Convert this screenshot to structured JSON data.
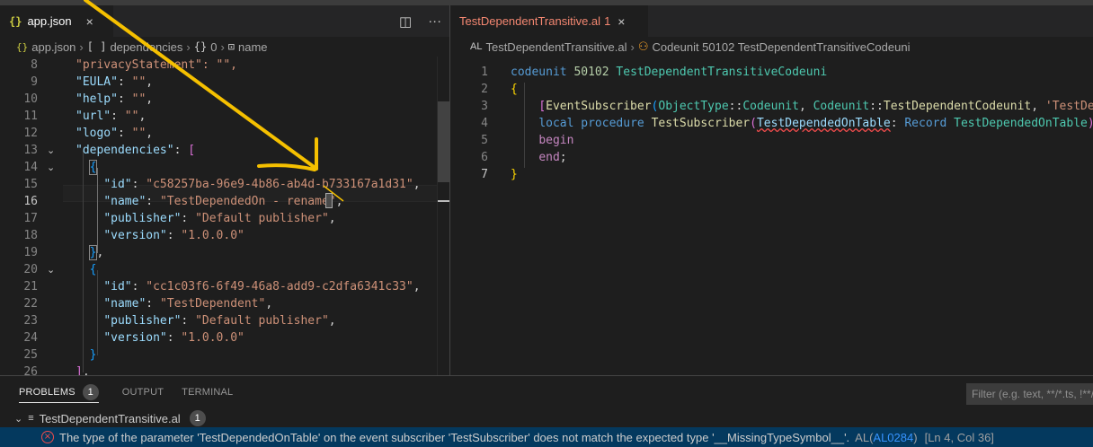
{
  "left_editor": {
    "tab": {
      "icon": "{}",
      "label": "app.json",
      "close": "×"
    },
    "actions": {
      "split": "◫",
      "more": "···"
    },
    "breadcrumb": {
      "file_icon": "{}",
      "file": "app.json",
      "seg1_icon": "[ ]",
      "seg1": "dependencies",
      "seg2_icon": "{}",
      "seg2": "0",
      "seg3_icon": "⊡",
      "seg3": "name",
      "sep": "›"
    },
    "lines": [
      {
        "n": "8",
        "tokens": [
          [
            "s",
            "\"privacyStatement\": \"\","
          ]
        ]
      },
      {
        "n": "9",
        "tokens": [
          [
            "k",
            "\"EULA\""
          ],
          [
            "p",
            ": "
          ],
          [
            "s",
            "\"\""
          ],
          [
            "p",
            ","
          ]
        ]
      },
      {
        "n": "10",
        "tokens": [
          [
            "k",
            "\"help\""
          ],
          [
            "p",
            ": "
          ],
          [
            "s",
            "\"\""
          ],
          [
            "p",
            ","
          ]
        ]
      },
      {
        "n": "11",
        "tokens": [
          [
            "k",
            "\"url\""
          ],
          [
            "p",
            ": "
          ],
          [
            "s",
            "\"\""
          ],
          [
            "p",
            ","
          ]
        ]
      },
      {
        "n": "12",
        "tokens": [
          [
            "k",
            "\"logo\""
          ],
          [
            "p",
            ": "
          ],
          [
            "s",
            "\"\""
          ],
          [
            "p",
            ","
          ]
        ]
      },
      {
        "n": "13",
        "tokens": [
          [
            "k",
            "\"dependencies\""
          ],
          [
            "p",
            ": "
          ],
          [
            "br1",
            "["
          ]
        ]
      },
      {
        "n": "14",
        "tokens": [
          [
            "p",
            "  "
          ],
          [
            "br2",
            "{"
          ]
        ]
      },
      {
        "n": "15",
        "tokens": [
          [
            "p",
            "    "
          ],
          [
            "k",
            "\"id\""
          ],
          [
            "p",
            ": "
          ],
          [
            "s",
            "\"c58257ba-96e9-4b86-ab4d-b733167a1d31\""
          ],
          [
            "p",
            ","
          ]
        ]
      },
      {
        "n": "16",
        "tokens": [
          [
            "p",
            "    "
          ],
          [
            "k",
            "\"name\""
          ],
          [
            "p",
            ": "
          ],
          [
            "s",
            "\"TestDependedOn - rename\""
          ],
          [
            "p",
            ","
          ]
        ]
      },
      {
        "n": "17",
        "tokens": [
          [
            "p",
            "    "
          ],
          [
            "k",
            "\"publisher\""
          ],
          [
            "p",
            ": "
          ],
          [
            "s",
            "\"Default publisher\""
          ],
          [
            "p",
            ","
          ]
        ]
      },
      {
        "n": "18",
        "tokens": [
          [
            "p",
            "    "
          ],
          [
            "k",
            "\"version\""
          ],
          [
            "p",
            ": "
          ],
          [
            "s",
            "\"1.0.0.0\""
          ]
        ]
      },
      {
        "n": "19",
        "tokens": [
          [
            "p",
            "  "
          ],
          [
            "br2",
            "}"
          ],
          [
            "p",
            ","
          ]
        ]
      },
      {
        "n": "20",
        "tokens": [
          [
            "p",
            "  "
          ],
          [
            "br2",
            "{"
          ]
        ]
      },
      {
        "n": "21",
        "tokens": [
          [
            "p",
            "    "
          ],
          [
            "k",
            "\"id\""
          ],
          [
            "p",
            ": "
          ],
          [
            "s",
            "\"cc1c03f6-6f49-46a8-add9-c2dfa6341c33\""
          ],
          [
            "p",
            ","
          ]
        ]
      },
      {
        "n": "22",
        "tokens": [
          [
            "p",
            "    "
          ],
          [
            "k",
            "\"name\""
          ],
          [
            "p",
            ": "
          ],
          [
            "s",
            "\"TestDependent\""
          ],
          [
            "p",
            ","
          ]
        ]
      },
      {
        "n": "23",
        "tokens": [
          [
            "p",
            "    "
          ],
          [
            "k",
            "\"publisher\""
          ],
          [
            "p",
            ": "
          ],
          [
            "s",
            "\"Default publisher\""
          ],
          [
            "p",
            ","
          ]
        ]
      },
      {
        "n": "24",
        "tokens": [
          [
            "p",
            "    "
          ],
          [
            "k",
            "\"version\""
          ],
          [
            "p",
            ": "
          ],
          [
            "s",
            "\"1.0.0.0\""
          ]
        ]
      },
      {
        "n": "25",
        "tokens": [
          [
            "p",
            "  "
          ],
          [
            "br2",
            "}"
          ]
        ]
      },
      {
        "n": "26",
        "tokens": [
          [
            "br1",
            "]"
          ],
          [
            "p",
            ","
          ]
        ]
      }
    ]
  },
  "right_editor": {
    "tab": {
      "label": "TestDependentTransitive.al",
      "count": "1",
      "close": "×"
    },
    "breadcrumb": {
      "file_icon": "AL",
      "file": "TestDependentTransitive.al",
      "sep": "›",
      "symbol_icon": "⚇",
      "symbol": "Codeunit 50102 TestDependentTransitiveCodeuni"
    },
    "lines": [
      {
        "n": "1",
        "tokens": [
          [
            "kw",
            "codeunit "
          ],
          [
            "num",
            "50102 "
          ],
          [
            "ty",
            "TestDependentTransitiveCodeuni"
          ]
        ]
      },
      {
        "n": "2",
        "tokens": [
          [
            "br3",
            "{"
          ]
        ]
      },
      {
        "n": "3",
        "tokens": [
          [
            "p",
            "    "
          ],
          [
            "br1",
            "["
          ],
          [
            "fn",
            "EventSubscriber"
          ],
          [
            "br2",
            "("
          ],
          [
            "ty",
            "ObjectType"
          ],
          [
            "p",
            "::"
          ],
          [
            "ty",
            "Codeunit"
          ],
          [
            "p",
            ", "
          ],
          [
            "ty",
            "Codeunit"
          ],
          [
            "p",
            "::"
          ],
          [
            "fn",
            "TestDependentCodeunit"
          ],
          [
            "p",
            ", "
          ],
          [
            "s",
            "'TestDep"
          ]
        ]
      },
      {
        "n": "4",
        "tokens": [
          [
            "p",
            "    "
          ],
          [
            "kw",
            "local "
          ],
          [
            "kw",
            "procedure "
          ],
          [
            "fn",
            "TestSubscriber"
          ],
          [
            "br1",
            "("
          ],
          [
            "sq",
            "TestDependedOnTable"
          ],
          [
            "p",
            ": "
          ],
          [
            "kw",
            "Record "
          ],
          [
            "ty",
            "TestDependedOnTable"
          ],
          [
            "br1",
            ")"
          ]
        ]
      },
      {
        "n": "5",
        "tokens": [
          [
            "p",
            "    "
          ],
          [
            "ctl",
            "begin"
          ]
        ]
      },
      {
        "n": "6",
        "tokens": [
          [
            "p",
            "    "
          ],
          [
            "ctl",
            "end"
          ],
          [
            "p",
            ";"
          ]
        ]
      },
      {
        "n": "7",
        "tokens": [
          [
            "br3",
            "}"
          ]
        ]
      }
    ]
  },
  "panel": {
    "tabs": [
      {
        "label": "PROBLEMS",
        "badge": "1"
      },
      {
        "label": "OUTPUT"
      },
      {
        "label": "TERMINAL"
      }
    ],
    "filter_placeholder": "Filter (e.g. text, **/*.ts, !**/",
    "file_row": {
      "chevron": "⌄",
      "file_icon": "≡",
      "file": "TestDependentTransitive.al",
      "count": "1"
    },
    "error_row": {
      "icon": "×",
      "message": "The type of the parameter 'TestDependedOnTable' on the event subscriber 'TestSubscriber' does not match the expected type '__MissingTypeSymbol__'.",
      "source": "AL(",
      "code": "AL0284",
      "source_end": ")",
      "position": "[Ln 4, Col 36]"
    }
  },
  "colors": {
    "annotation": "#f5c000",
    "error": "#f14c4c",
    "accent": "#3794ff"
  }
}
